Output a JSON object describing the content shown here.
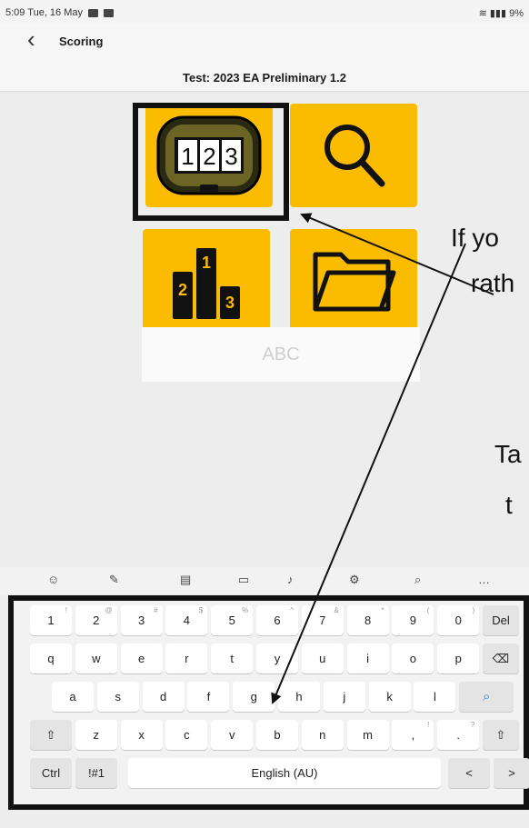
{
  "status_bar": {
    "time_date": "5:09  Tue, 16 May",
    "right_indicators": "9%"
  },
  "app_bar": {
    "title": "Scoring",
    "test_label": "Test: 2023 EA Preliminary 1.2"
  },
  "tiles": {
    "counter_digits": [
      "1",
      "2",
      "3"
    ],
    "podium_numbers": {
      "second": "2",
      "first": "1",
      "third": "3"
    }
  },
  "search_input": {
    "placeholder": "ABC"
  },
  "overlay_text": {
    "line1": "If yo",
    "line2": "rath",
    "line3": "Ta",
    "line4": "t"
  },
  "keyboard_toolbar": [
    "emoji-icon",
    "handwriting-icon",
    "clipboard-icon",
    "keyboard-mode-icon",
    "microphone-icon",
    "settings-icon",
    "search-icon",
    "more-icon"
  ],
  "keyboard": {
    "rows": [
      [
        {
          "k": "1",
          "s": "!"
        },
        {
          "k": "2",
          "s": "@"
        },
        {
          "k": "3",
          "s": "#"
        },
        {
          "k": "4",
          "s": "$"
        },
        {
          "k": "5",
          "s": "%"
        },
        {
          "k": "6",
          "s": "^"
        },
        {
          "k": "7",
          "s": "&"
        },
        {
          "k": "8",
          "s": "*"
        },
        {
          "k": "9",
          "s": "("
        },
        {
          "k": "0",
          "s": ")"
        },
        {
          "k": "Del",
          "s": ""
        }
      ],
      [
        {
          "k": "q",
          "s": ""
        },
        {
          "k": "w",
          "s": ""
        },
        {
          "k": "e",
          "s": ""
        },
        {
          "k": "r",
          "s": ""
        },
        {
          "k": "t",
          "s": ""
        },
        {
          "k": "y",
          "s": ""
        },
        {
          "k": "u",
          "s": ""
        },
        {
          "k": "i",
          "s": ""
        },
        {
          "k": "o",
          "s": ""
        },
        {
          "k": "p",
          "s": ""
        },
        {
          "k": "⌫",
          "s": ""
        }
      ],
      [
        {
          "k": "a",
          "s": ""
        },
        {
          "k": "s",
          "s": ""
        },
        {
          "k": "d",
          "s": ""
        },
        {
          "k": "f",
          "s": ""
        },
        {
          "k": "g",
          "s": ""
        },
        {
          "k": "h",
          "s": ""
        },
        {
          "k": "j",
          "s": ""
        },
        {
          "k": "k",
          "s": ""
        },
        {
          "k": "l",
          "s": ""
        },
        {
          "k": "🔍",
          "s": ""
        }
      ],
      [
        {
          "k": "⇧",
          "s": ""
        },
        {
          "k": "z",
          "s": ""
        },
        {
          "k": "x",
          "s": ""
        },
        {
          "k": "c",
          "s": ""
        },
        {
          "k": "v",
          "s": ""
        },
        {
          "k": "b",
          "s": ""
        },
        {
          "k": "n",
          "s": ""
        },
        {
          "k": "m",
          "s": ""
        },
        {
          "k": ",",
          "s": "!"
        },
        {
          "k": ".",
          "s": "?"
        },
        {
          "k": "⇧",
          "s": ""
        }
      ],
      [
        {
          "k": "Ctrl",
          "s": ""
        },
        {
          "k": "!#1",
          "s": ""
        },
        {
          "k": "English (AU)",
          "s": ""
        },
        {
          "k": "<",
          "s": ""
        },
        {
          "k": ">",
          "s": ""
        }
      ]
    ]
  },
  "colors": {
    "accent": "#fbbc00",
    "background": "#ededed"
  }
}
